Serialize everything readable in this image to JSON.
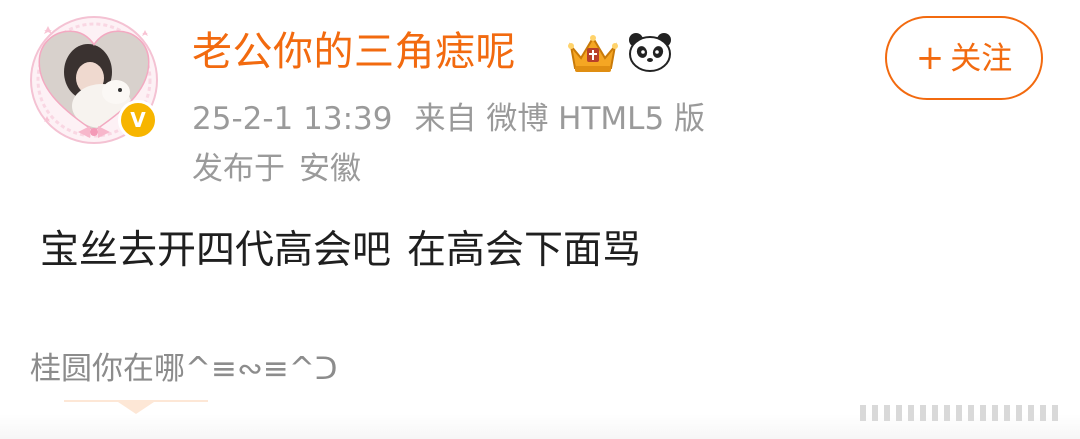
{
  "post_header": {
    "username": "老公你的三角痣呢",
    "badges": [
      {
        "icon": "crown-badge-icon",
        "color": "#f5a623"
      },
      {
        "icon": "panda-icon",
        "color": "#222222"
      }
    ],
    "verified_badge": "V",
    "timestamp": "25-2-1 13:39",
    "source": "来自 微博 HTML5 版",
    "location_prefix": "发布于",
    "location": "安徽"
  },
  "follow_button": {
    "icon": "plus-icon",
    "plus": "+",
    "label": "关注"
  },
  "post_body": {
    "text_part1": "宝丝去开四代高会吧",
    "text_part2": "在高会下面骂"
  },
  "comment_preview": {
    "text": "桂圆你在哪^≡∾≡^ᑐ"
  },
  "colors": {
    "accent": "#f26a0f",
    "meta_text": "#9a9a9a",
    "body_text": "#1f1f1f",
    "verified": "#f7b500",
    "avatar_frame": "#f9c6d6"
  }
}
